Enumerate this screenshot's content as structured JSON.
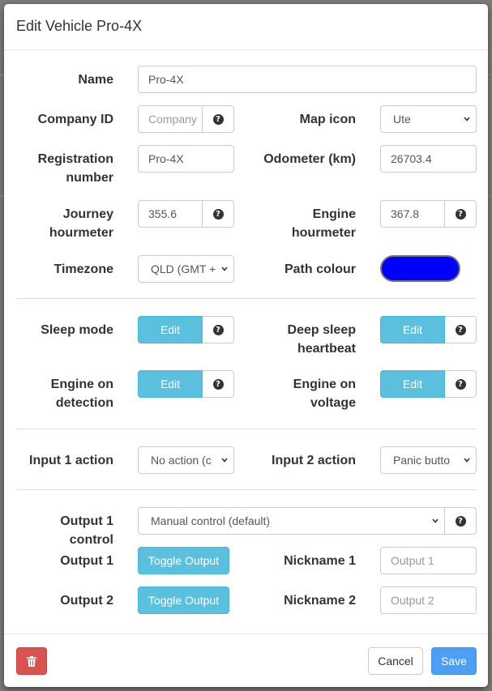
{
  "modal": {
    "title": "Edit Vehicle Pro-4X"
  },
  "fields": {
    "name": {
      "label": "Name",
      "value": "Pro-4X"
    },
    "company_id": {
      "label": "Company ID",
      "placeholder": "Company"
    },
    "map_icon": {
      "label": "Map icon",
      "value": "Ute"
    },
    "registration": {
      "label_line1": "Registration",
      "label_line2": "number",
      "value": "Pro-4X"
    },
    "odometer": {
      "label": "Odometer (km)",
      "value": "26703.4"
    },
    "journey_hourmeter": {
      "label_line1": "Journey",
      "label_line2": "hourmeter",
      "value": "355.6"
    },
    "engine_hourmeter": {
      "label_line1": "Engine",
      "label_line2": "hourmeter",
      "value": "367.8"
    },
    "timezone": {
      "label": "Timezone",
      "value": "QLD (GMT +"
    },
    "path_colour": {
      "label": "Path colour",
      "color": "#0000ff"
    }
  },
  "sleep": {
    "sleep_mode": {
      "label": "Sleep mode",
      "button": "Edit"
    },
    "deep_sleep": {
      "label_line1": "Deep sleep",
      "label_line2": "heartbeat",
      "button": "Edit"
    },
    "engine_detection": {
      "label_line1": "Engine on",
      "label_line2": "detection",
      "button": "Edit"
    },
    "engine_voltage": {
      "label_line1": "Engine on",
      "label_line2": "voltage",
      "button": "Edit"
    }
  },
  "inputs": {
    "input1": {
      "label": "Input 1 action",
      "value": "No action (c"
    },
    "input2": {
      "label": "Input 2 action",
      "value": "Panic butto"
    }
  },
  "outputs": {
    "control": {
      "label": "Output 1 control",
      "value": "Manual control (default)"
    },
    "output1": {
      "label": "Output 1",
      "button": "Toggle Output"
    },
    "output2": {
      "label": "Output 2",
      "button": "Toggle Output"
    },
    "nickname1": {
      "label": "Nickname 1",
      "placeholder": "Output 1"
    },
    "nickname2": {
      "label": "Nickname 2",
      "placeholder": "Output 2"
    }
  },
  "footer": {
    "cancel": "Cancel",
    "save": "Save"
  },
  "icons": {
    "help": "?",
    "delete": "trash-icon"
  },
  "colors": {
    "info": "#5bc0de",
    "primary": "#4c9ff5",
    "danger": "#d9534f"
  }
}
